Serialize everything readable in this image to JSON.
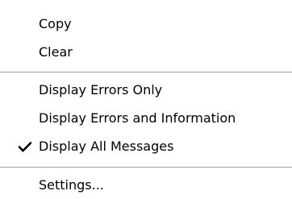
{
  "menu": {
    "items": {
      "copy": "Copy",
      "clear": "Clear",
      "display_errors_only": "Display Errors Only",
      "display_errors_and_information": "Display Errors and Information",
      "display_all_messages": "Display All Messages",
      "settings": "Settings..."
    },
    "checked_item": "display_all_messages",
    "check_icon": "checkmark-icon",
    "colors": {
      "background": "#ffffff",
      "text": "#000000",
      "separator": "#a0a0a0"
    }
  }
}
